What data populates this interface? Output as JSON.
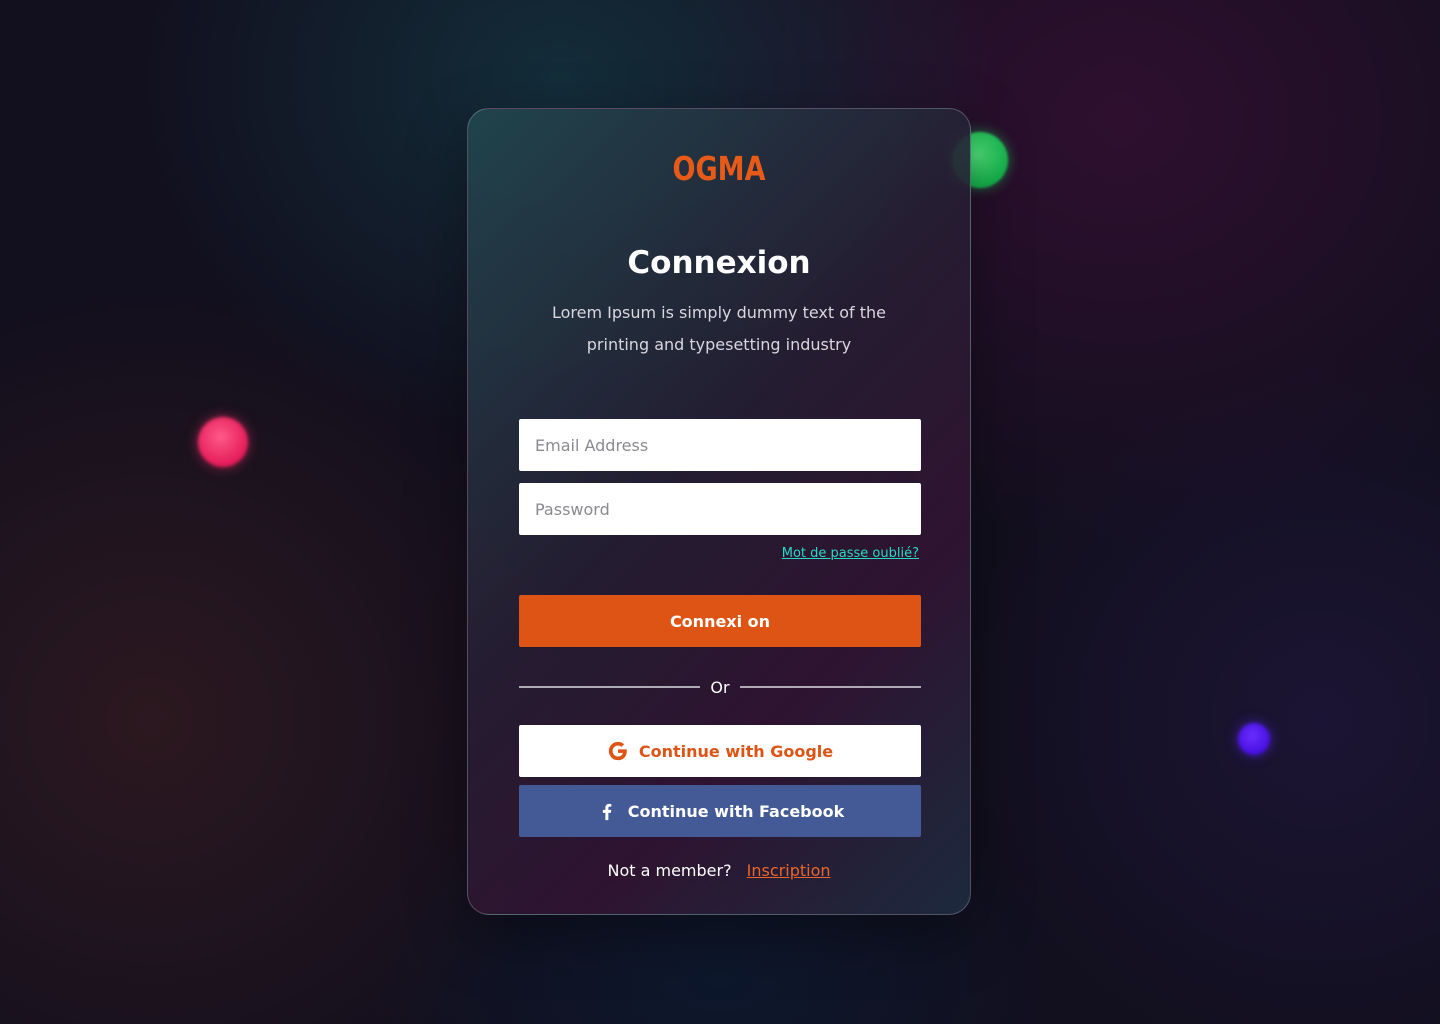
{
  "brand": {
    "logo_text": "OGMA",
    "accent_color": "#de5414",
    "link_color": "#29d8c8"
  },
  "login": {
    "title": "Connexion",
    "subtitle": "Lorem Ipsum is simply dummy text of the printing and typesetting industry",
    "email_placeholder": "Email Address",
    "password_placeholder": "Password",
    "forgot_password": "Mot de passe oublié?",
    "submit_label": "Connexi on",
    "divider_text": "Or",
    "google_label": "Continue with Google",
    "facebook_label": "Continue with Facebook",
    "google_icon": "google-icon",
    "facebook_icon": "facebook-icon",
    "not_member_text": "Not a member?",
    "signup_label": "Inscription"
  },
  "decor": {
    "orbs": [
      "green",
      "pink",
      "purple"
    ]
  }
}
